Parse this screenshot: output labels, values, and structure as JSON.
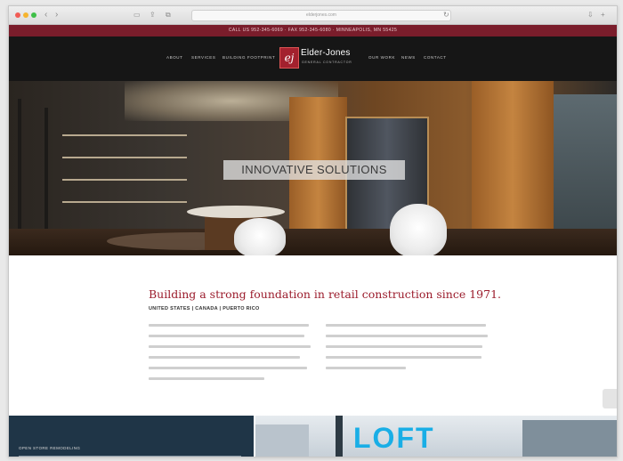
{
  "browser": {
    "address": "elderjones.com"
  },
  "topbar": {
    "text": "CALL US 952-345-6069 · FAX 952-345-6080 · MINNEAPOLIS, MN 55425"
  },
  "header": {
    "menu_left": [
      "ABOUT",
      "SERVICES",
      "BUILDING FOOTPRINT"
    ],
    "menu_right": [
      "OUR WORK",
      "NEWS",
      "CONTACT"
    ],
    "logo_mark": "ej",
    "logo_name": "Elder-Jones",
    "logo_sub": "GENERAL CONTRACTOR"
  },
  "hero": {
    "title": "INNOVATIVE SOLUTIONS"
  },
  "content": {
    "headline": "Building a strong foundation in retail construction since 1971.",
    "subline": "UNITED STATES | CANADA | PUERTO RICO"
  },
  "bottom": {
    "left_title": "OPEN STORE REMODELING",
    "sign_text": "LOFT"
  },
  "colors": {
    "brand": "#9b1c2c",
    "topbar": "#7a1d2b",
    "header": "#161616",
    "navy": "#1f3547"
  }
}
